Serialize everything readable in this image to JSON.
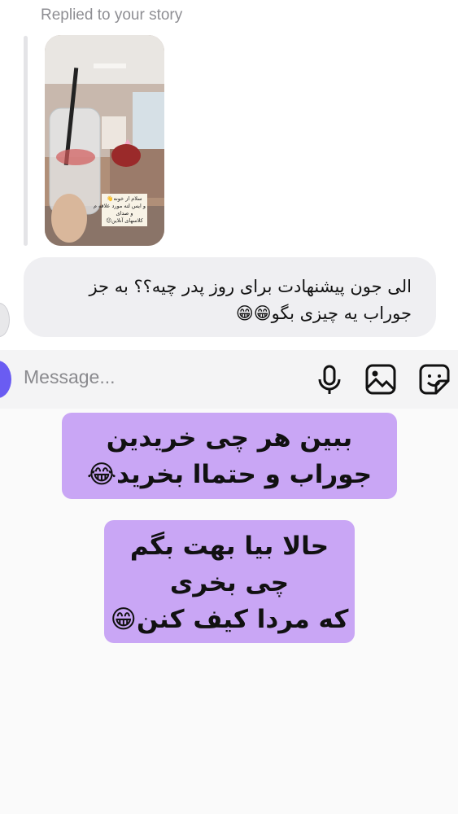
{
  "header": {
    "replied_label": "Replied to your story"
  },
  "story": {
    "caption_lines": [
      "سلام از خونه👋",
      "و ایس لته مورد علاقه م",
      "و صدای",
      "کلاسهای آنلاین😕"
    ]
  },
  "message": {
    "lines": [
      "الی جون پیشنهادت برای روز پدر چیه؟؟ به جز",
      "جوراب یه چیزی بگو😁😁"
    ]
  },
  "composer": {
    "placeholder": "Message...",
    "icons": [
      "camera-icon",
      "microphone-icon",
      "gallery-icon",
      "sticker-icon"
    ]
  },
  "overlay_notes": [
    {
      "lines": [
        "ببین هر چی خریدین",
        "جوراب و حتماا بخرید😂"
      ]
    },
    {
      "lines": [
        "حالا بیا بهت بگم",
        "چی بخری",
        "که مردا کیف کنن😁"
      ]
    }
  ],
  "colors": {
    "note_bg": "#c9a6f5",
    "bubble_bg": "#efeff2",
    "composer_bg": "#f4f4f5",
    "accent": "#6a5cf2"
  }
}
